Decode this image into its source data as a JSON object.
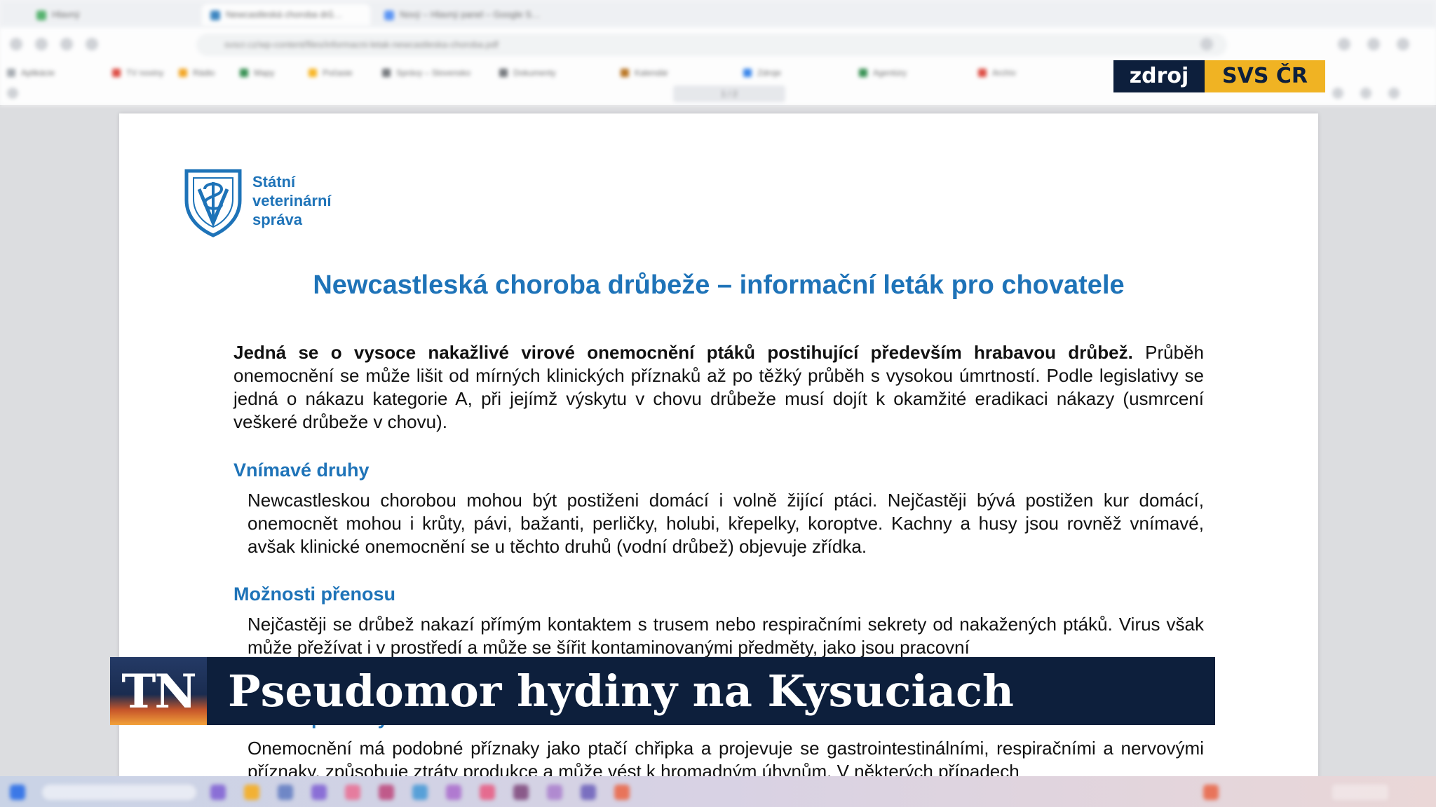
{
  "browser": {
    "tabs": [
      {
        "label": "Hlavný",
        "favicon_color": "#3aa757"
      },
      {
        "label": "Newcastleská choroba drů…",
        "favicon_color": "#1e73b8"
      },
      {
        "label": "Nový – Hlavný panel – Google S…",
        "favicon_color": "#4285f4"
      }
    ],
    "address": "svscr.cz/wp-content/files/informacni-letak-newcastleska-choroba.pdf",
    "bookmarks": [
      {
        "label": "Aplikácie",
        "color": "#9aa0a6"
      },
      {
        "label": "TV noviny",
        "color": "#d93025"
      },
      {
        "label": "Rádio",
        "color": "#f29900"
      },
      {
        "label": "Mapy",
        "color": "#188038"
      },
      {
        "label": "Počasie",
        "color": "#f9ab00"
      },
      {
        "label": "Správy – Slovensko",
        "color": "#5f6368"
      },
      {
        "label": "Dokumenty",
        "color": "#5f6368"
      },
      {
        "label": "Kalendár",
        "color": "#b06000"
      },
      {
        "label": "Zdroje",
        "color": "#1a73e8"
      },
      {
        "label": "Agentúry",
        "color": "#188038"
      },
      {
        "label": "Archív",
        "color": "#d93025"
      }
    ],
    "pdf_page": "1 / 2"
  },
  "source_badge": {
    "label": "zdroj",
    "value": "SVS ČR"
  },
  "document": {
    "logo": {
      "line1": "Státní",
      "line2": "veterinární",
      "line3": "správa",
      "color": "#1e73b8"
    },
    "title": "Newcastleská choroba drůbeže – informační leták pro chovatele",
    "intro_bold": "Jedná se o vysoce nakažlivé virové onemocnění ptáků postihující především hrabavou drůbež.",
    "intro_rest": "Průběh onemocnění se může lišit od mírných klinických příznaků až po těžký průběh s vysokou úmrtností. Podle legislativy se jedná o nákazu kategorie A, při jejímž výskytu v chovu drůbeže musí dojít k okamžité eradikaci nákazy (usmrcení veškeré drůbeže v chovu).",
    "sections": [
      {
        "heading": "Vnímavé druhy",
        "body": "Newcastleskou chorobou mohou být postiženi domácí i volně žijící ptáci. Nejčastěji bývá postižen kur domácí, onemocnět mohou i krůty, pávi, bažanti, perličky, holubi, křepelky, koroptve. Kachny a husy jsou rovněž vnímavé, avšak klinické onemocnění se u těchto druhů (vodní drůbež) objevuje zřídka."
      },
      {
        "heading": "Možnosti přenosu",
        "body": "Nejčastěji se drůbež nakazí přímým kontaktem s trusem nebo respiračními sekrety od nakažených ptáků. Virus však může přežívat i v prostředí a může se šířit kontaminovanými předměty, jako jsou pracovní"
      },
      {
        "heading": "Klinické příznaky",
        "body": "Onemocnění má podobné příznaky jako ptačí chřipka a projevuje se gastrointestinálními, respiračními a nervovými příznaky, způsobuje ztráty produkce a může vést k hromadným úhynům. V některých případech"
      }
    ]
  },
  "lower_third": {
    "logo": "TN",
    "headline": "Pseudomor hydiny na Kysuciach"
  },
  "colors": {
    "accent_blue": "#1e73b8",
    "navy": "#0d1f3c",
    "badge_gold": "#f0b323"
  },
  "taskbar": {
    "icons": [
      "#3b78e7",
      "#8a6fd6",
      "#f2b134",
      "#6f87c6",
      "#8a6fd6",
      "#e67c9e",
      "#c05a8a",
      "#57a0d8",
      "#b07ad0",
      "#e56b8f",
      "#8a5a8a",
      "#b08ad0",
      "#7a6fc0",
      "#e8745a"
    ]
  }
}
